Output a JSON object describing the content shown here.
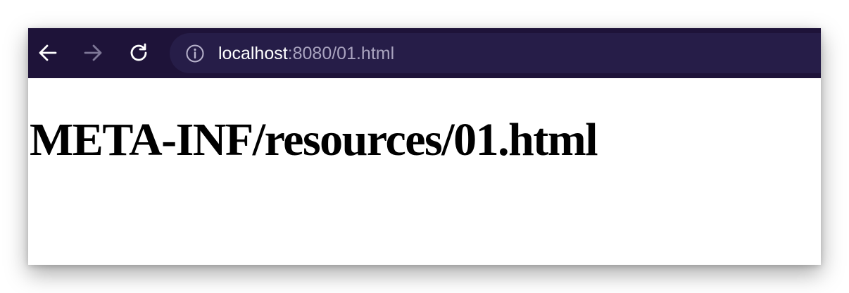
{
  "browser": {
    "nav": {
      "back_icon": "arrow-left-icon",
      "forward_icon": "arrow-right-icon",
      "reload_icon": "reload-icon"
    },
    "address_bar": {
      "info_icon": "info-circle-icon",
      "host": "localhost",
      "path": ":8080/01.html"
    },
    "colors": {
      "toolbar": "#1e1339",
      "address_bar": "#261d48",
      "url_host": "#ffffff",
      "url_path": "#a9a3bf",
      "forward_disabled": "#7e7797"
    }
  },
  "page": {
    "heading": "META-INF/resources/01.html"
  }
}
